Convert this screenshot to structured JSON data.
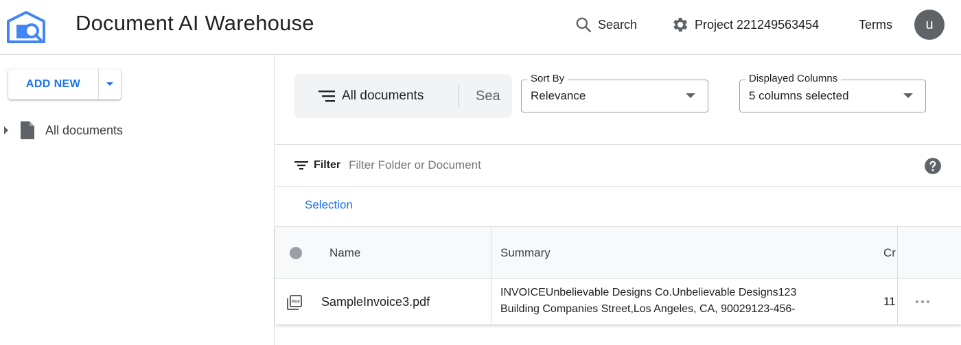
{
  "header": {
    "app_title": "Document AI Warehouse",
    "search_label": "Search",
    "project_label": "Project 221249563454",
    "terms_label": "Terms",
    "avatar_initial": "u"
  },
  "left_panel": {
    "add_new_label": "ADD NEW",
    "tree": [
      {
        "label": "All documents",
        "icon": "file-icon"
      }
    ]
  },
  "toolbar": {
    "view_label": "All documents",
    "search_tab_label": "Sea",
    "sort_by": {
      "label": "Sort By",
      "value": "Relevance"
    },
    "displayed_columns": {
      "label": "Displayed Columns",
      "value": "5 columns selected"
    }
  },
  "filter": {
    "label": "Filter",
    "placeholder": "Filter Folder or Document"
  },
  "selection_label": "Selection",
  "table": {
    "columns": [
      "Name",
      "Summary",
      "Cr"
    ],
    "rows": [
      {
        "name": "SampleInvoice3.pdf",
        "summary_line1": "INVOICEUnbelievable Designs Co.Unbelievable Designs123",
        "summary_line2": "Building Companies Street,Los Angeles, CA, 90029123-456-",
        "created": "11",
        "icon": "pdf-icon"
      }
    ]
  },
  "colors": {
    "accent": "#1a73e8",
    "border": "#dadce0",
    "avatar_bg": "#5f6368",
    "logo": "#4285f4"
  }
}
